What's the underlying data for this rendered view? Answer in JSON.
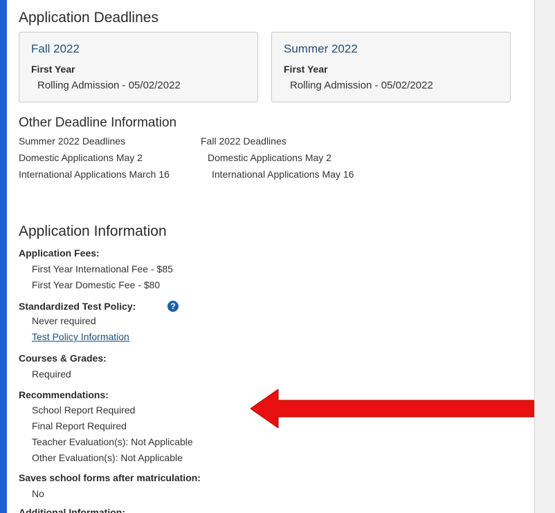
{
  "deadlines": {
    "heading": "Application Deadlines",
    "cards": [
      {
        "term": "Fall 2022",
        "type": "First Year",
        "desc": "Rolling Admission - 05/02/2022"
      },
      {
        "term": "Summer 2022",
        "type": "First Year",
        "desc": "Rolling Admission - 05/02/2022"
      }
    ]
  },
  "other": {
    "heading": "Other Deadline Information",
    "summer": {
      "title": "Summer 2022 Deadlines",
      "domestic": "Domestic Applications May 2",
      "international": "International Applications March 16"
    },
    "fall": {
      "title": "Fall 2022 Deadlines",
      "domestic": "Domestic Applications May 2",
      "international": "International Applications May 16"
    }
  },
  "appinfo": {
    "heading": "Application Information",
    "fees_label": "Application Fees:",
    "fees": [
      "First Year International Fee - $85",
      "First Year Domestic Fee - $80"
    ],
    "test_label": "Standardized Test Policy:",
    "help_icon": "question-circle-icon",
    "test_value": "Never required",
    "test_link": "Test Policy Information",
    "courses_label": "Courses & Grades:",
    "courses_value": "Required",
    "rec_label": "Recommendations:",
    "recs": [
      "School Report Required",
      "Final Report Required",
      "Teacher Evaluation(s): Not Applicable",
      "Other Evaluation(s): Not Applicable"
    ],
    "saves_label": "Saves school forms after matriculation:",
    "saves_value": "No",
    "additional_label": "Additional Information:"
  },
  "annotation": {
    "arrow_color": "#e81010",
    "arrow_icon": "left-arrow-icon"
  },
  "colors": {
    "background": "#1f5fd6",
    "link": "#1e4f7c"
  }
}
